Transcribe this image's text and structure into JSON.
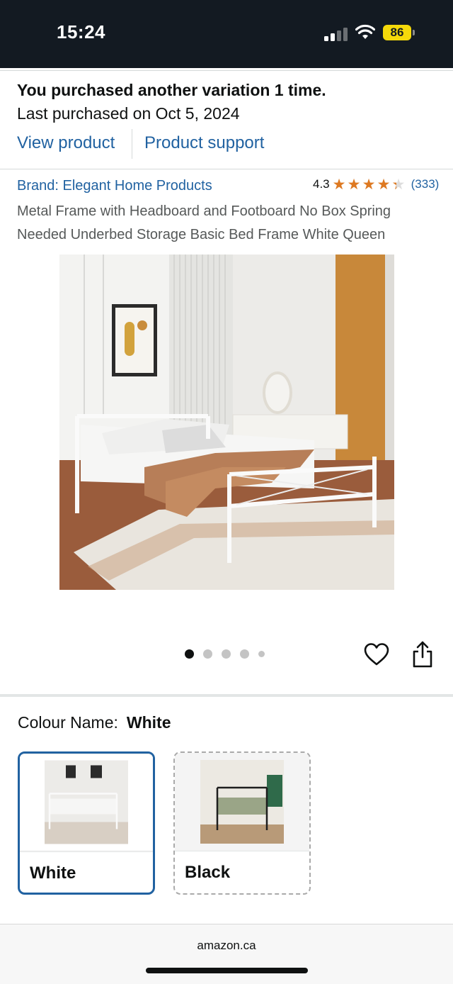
{
  "status_bar": {
    "time": "15:24",
    "battery": "86",
    "icons": [
      "cellular-signal-icon",
      "wifi-icon",
      "battery-icon"
    ]
  },
  "purchase_notice": {
    "title": "You purchased another variation 1 time.",
    "last_purchased": "Last purchased on Oct 5, 2024",
    "view_product": "View product",
    "product_support": "Product support"
  },
  "product": {
    "brand": "Brand: Elegant Home Products",
    "rating_value": "4.3",
    "rating_stars": 4.3,
    "rating_count": "(333)",
    "title": "Metal Frame with Headboard and Footboard No Box Spring Needed Underbed Storage Basic Bed Frame White Queen",
    "image_count": 5,
    "active_image": 0
  },
  "colour": {
    "label": "Colour Name:",
    "selected": "White",
    "options": [
      {
        "label": "White",
        "selected": true
      },
      {
        "label": "Black",
        "selected": false
      }
    ]
  },
  "browser": {
    "url": "amazon.ca"
  },
  "colors": {
    "link": "#2162a1",
    "star": "#de7921",
    "status_bar_bg": "#131a22",
    "battery": "#f5d90a"
  }
}
